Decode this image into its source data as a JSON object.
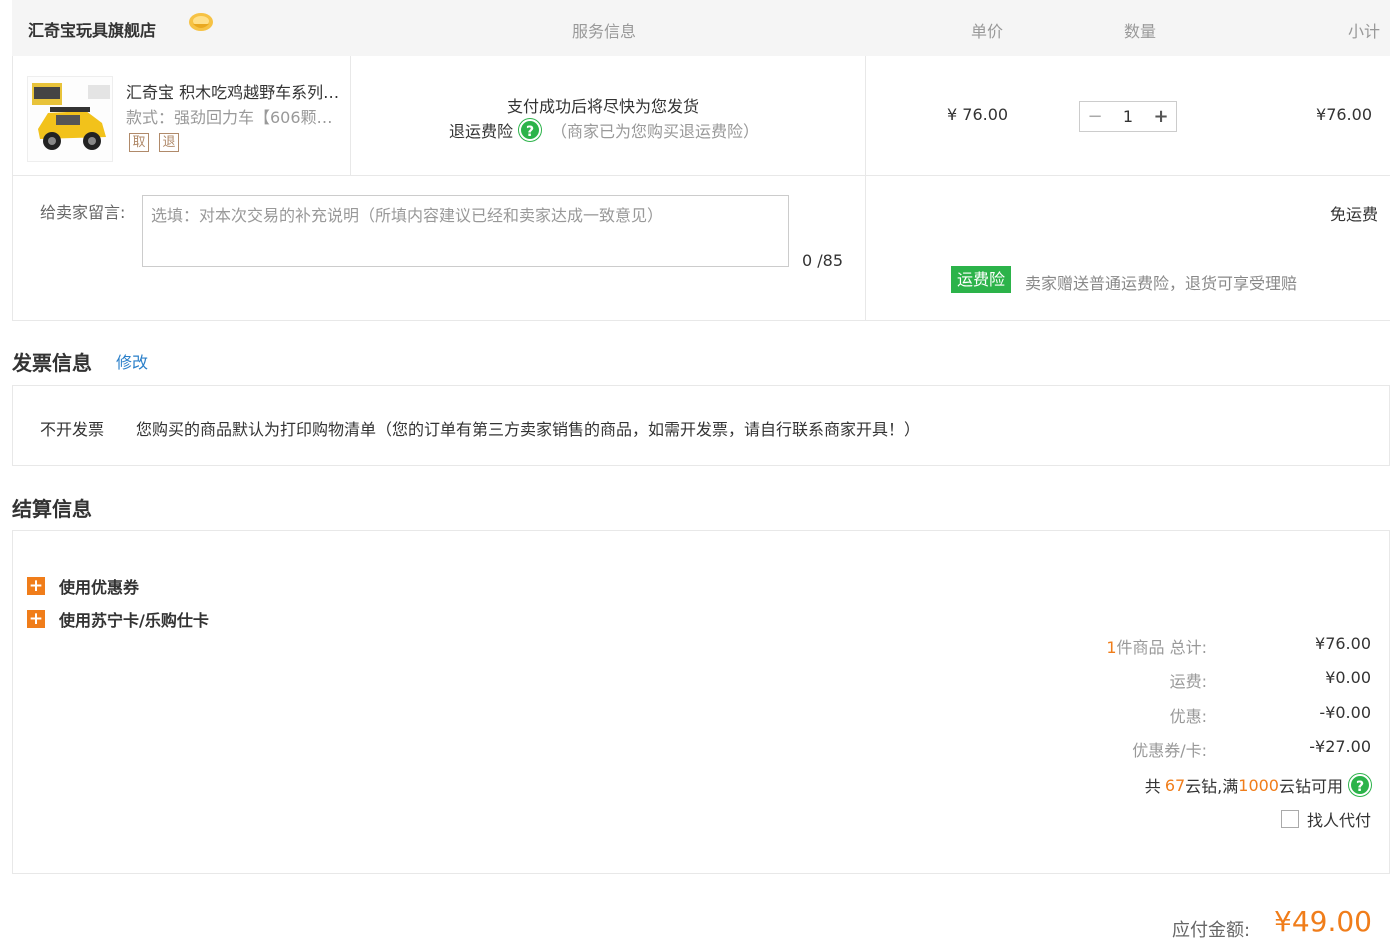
{
  "store": {
    "name": "汇奇宝玩具旗舰店"
  },
  "columns": {
    "service": "服务信息",
    "unit_price": "单价",
    "quantity": "数量",
    "subtotal": "小计"
  },
  "item": {
    "title": "汇奇宝 积木吃鸡越野车系列…",
    "spec": "款式：强劲回力车【606颗…",
    "tag_cancel": "取",
    "tag_return": "退",
    "service_line1": "支付成功后将尽快为您发货",
    "service_insurance": "退运费险",
    "service_note": "（商家已为您购买退运费险）",
    "unit_price": "¥ 76.00",
    "quantity": "1",
    "subtotal": "¥76.00"
  },
  "message": {
    "label": "给卖家留言:",
    "placeholder": "选填：对本次交易的补充说明（所填内容建议已经和卖家达成一致意见）",
    "count": "0 /85"
  },
  "shipping": {
    "free": "免运费",
    "insurance_badge": "运费险",
    "insurance_text": "卖家赠送普通运费险，退货可享受理赔"
  },
  "invoice": {
    "title": "发票信息",
    "edit": "修改",
    "type": "不开发票",
    "desc": "您购买的商品默认为打印购物清单（您的订单有第三方卖家销售的商品，如需开发票，请自行联系商家开具！）"
  },
  "settlement": {
    "title": "结算信息",
    "use_coupon": "使用优惠券",
    "use_card": "使用苏宁卡/乐购仕卡",
    "item_count": "1",
    "total_label": "件商品 总计:",
    "total_value": "¥76.00",
    "shipping_label": "运费:",
    "shipping_value": "¥0.00",
    "discount_label": "优惠:",
    "discount_value": "-¥0.00",
    "coupon_label": "优惠券/卡:",
    "coupon_value": "-¥27.00",
    "diamond_prefix": "共",
    "diamond_count": "67",
    "diamond_mid": "云钻,满",
    "diamond_min": "1000",
    "diamond_suffix": "云钻可用",
    "proxy_pay": "找人代付"
  },
  "payment": {
    "label": "应付金额:",
    "amount": "¥49.00"
  },
  "colors": {
    "accent": "#f07d1a",
    "green": "#2cb34a",
    "link": "#2a7fc9",
    "header_bg": "#f5f5f5"
  },
  "icons": {
    "store_badge": "gold-crown-badge-icon",
    "help": "question-circle-icon",
    "expand": "plus-square-icon"
  }
}
